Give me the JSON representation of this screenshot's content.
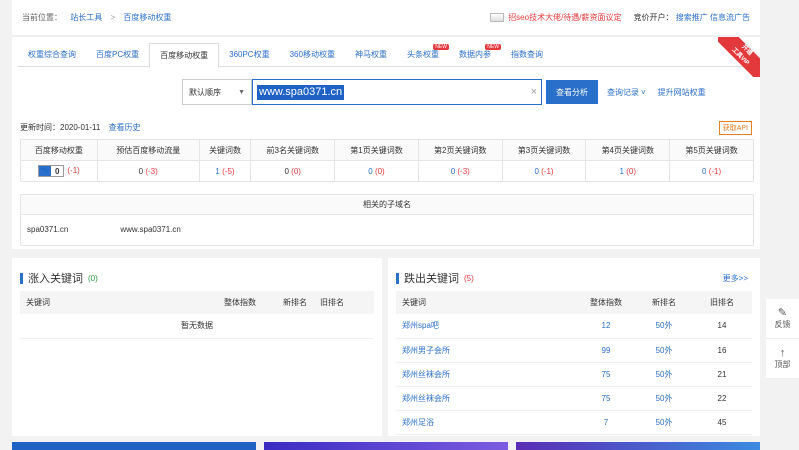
{
  "breadcrumb": {
    "prefix": "当前位置：",
    "root": "站长工具",
    "sep": ">",
    "current": "百度移动权重"
  },
  "topbar": {
    "promo": "招seo技术大佬/待遇/薪资面议定",
    "ad_label": "竞价开户：",
    "ad_links": [
      "搜索推广",
      "信息流广告"
    ]
  },
  "tabs": [
    {
      "label": "权重综合查询",
      "active": false,
      "new": false
    },
    {
      "label": "百度PC权重",
      "active": false,
      "new": false
    },
    {
      "label": "百度移动权重",
      "active": true,
      "new": false
    },
    {
      "label": "360PC权重",
      "active": false,
      "new": false
    },
    {
      "label": "360移动权重",
      "active": false,
      "new": false
    },
    {
      "label": "神马权重",
      "active": false,
      "new": false
    },
    {
      "label": "头条权重",
      "active": false,
      "new": true
    },
    {
      "label": "数据内参",
      "active": false,
      "new": true
    },
    {
      "label": "指数查询",
      "active": false,
      "new": false
    }
  ],
  "new_badge": "NEW",
  "vip": {
    "line1": "开通",
    "line2": "工具VIP"
  },
  "search": {
    "sort": "默认顺序",
    "value": "www.spa0371.cn",
    "clear": "×",
    "button": "查看分析",
    "history": "查询记录",
    "promote": "提升网站权重"
  },
  "updated": {
    "label": "更新时间：2020-01-11",
    "history_link": "查看历史"
  },
  "api_button": "获取API",
  "stats": {
    "headers": [
      "百度移动权重",
      "预估百度移动流量",
      "关键词数",
      "前3名关键词数",
      "第1页关键词数",
      "第2页关键词数",
      "第3页关键词数",
      "第4页关键词数",
      "第5页关键词数"
    ],
    "weight": {
      "value": "0",
      "change": "(-1)"
    },
    "cells": [
      {
        "value": "0",
        "change": "(-3)"
      },
      {
        "value": "1",
        "change": "(-5)"
      },
      {
        "value": "0",
        "change": "(0)"
      },
      {
        "value": "0",
        "change": "(0)"
      },
      {
        "value": "0",
        "change": "(-3)"
      },
      {
        "value": "0",
        "change": "(-1)"
      },
      {
        "value": "1",
        "change": "(0)"
      },
      {
        "value": "0",
        "change": "(-1)"
      }
    ]
  },
  "subdomains": {
    "title": "相关的子域名",
    "items": [
      "spa0371.cn",
      "www.spa0371.cn"
    ]
  },
  "up": {
    "title": "涨入关键词",
    "count": "(0)",
    "headers": [
      "关键词",
      "整体指数",
      "新排名",
      "旧排名"
    ],
    "empty": "暂无数据"
  },
  "down": {
    "title": "跌出关键词",
    "count": "(5)",
    "more": "更多>>",
    "headers": [
      "关键词",
      "整体指数",
      "新排名",
      "旧排名"
    ],
    "rows": [
      {
        "kw": "郑州spa吧",
        "idx": "12",
        "new": "50外",
        "old": "14"
      },
      {
        "kw": "郑州男子会所",
        "idx": "99",
        "new": "50外",
        "old": "16"
      },
      {
        "kw": "郑州丝袜会所",
        "idx": "75",
        "new": "50外",
        "old": "21"
      },
      {
        "kw": "郑州丝袜会所",
        "idx": "75",
        "new": "50外",
        "old": "22"
      },
      {
        "kw": "郑州足浴",
        "idx": "7",
        "new": "50外",
        "old": "45"
      }
    ]
  },
  "side": {
    "feedback": "反馈",
    "top": "顶部"
  },
  "colors": {
    "accent": "#2a6fc9",
    "red": "#e4393c",
    "green": "#2a9d3f"
  }
}
